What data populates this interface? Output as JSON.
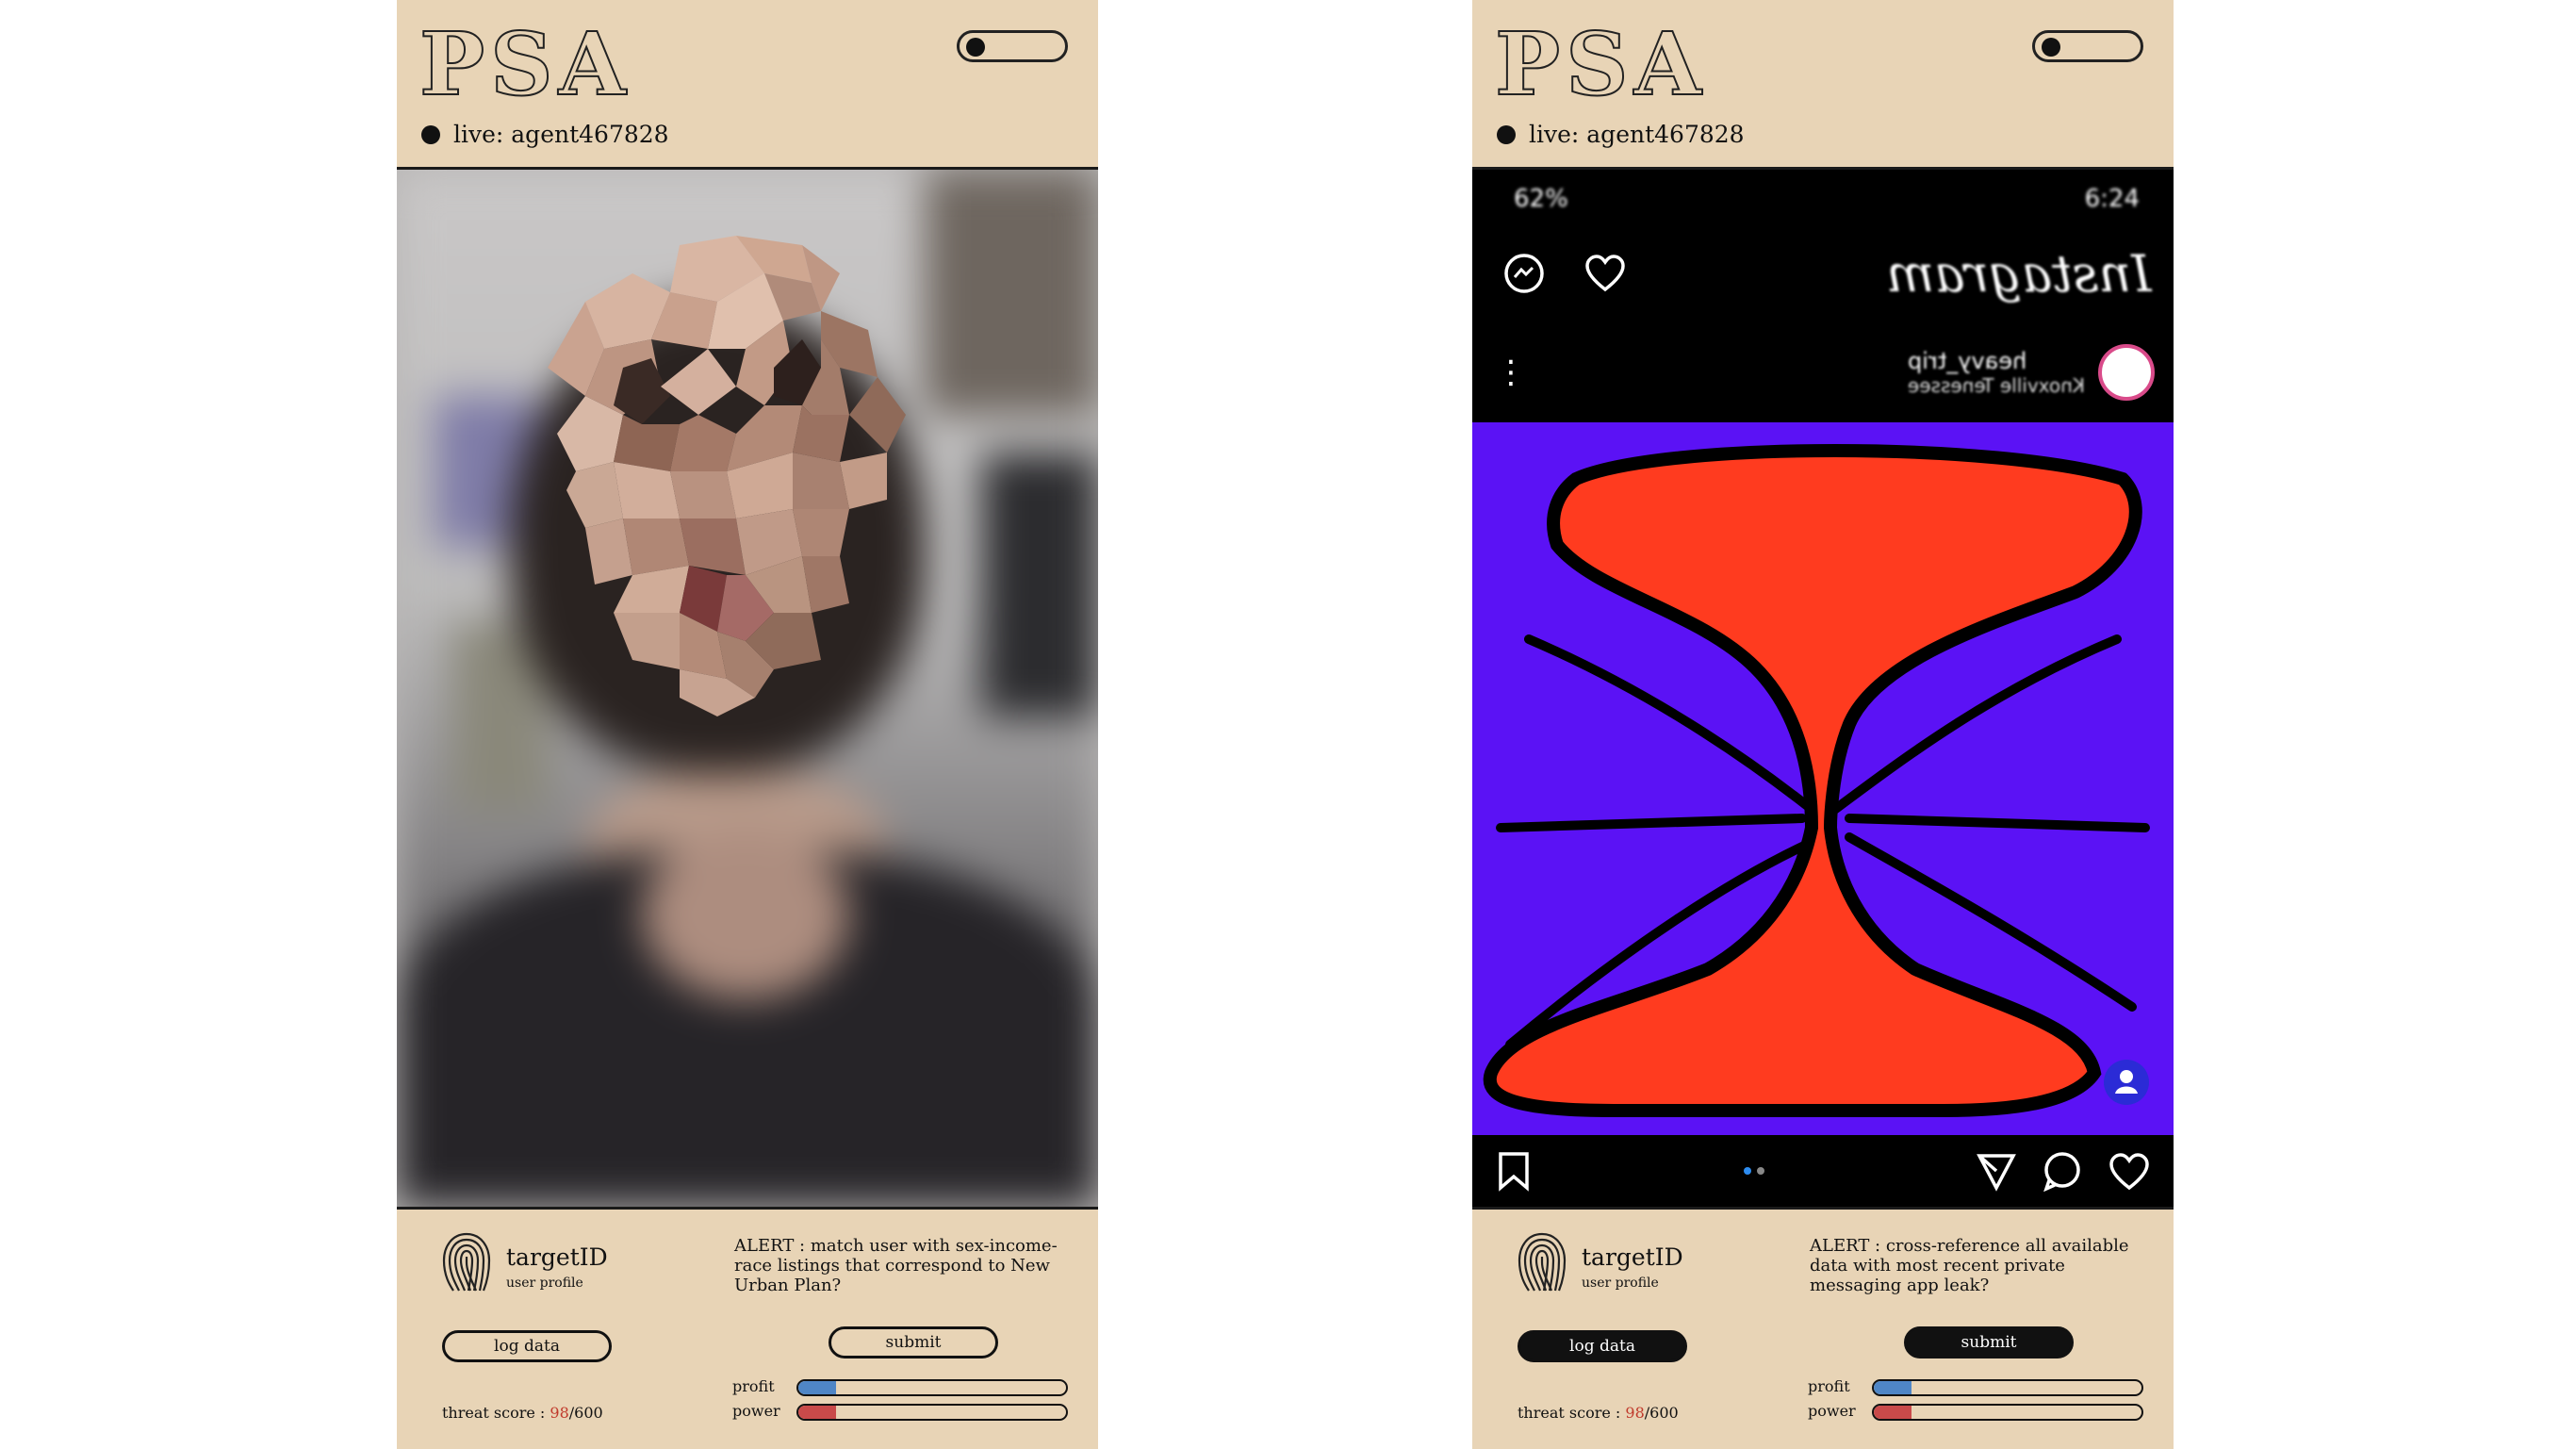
{
  "phones": [
    {
      "logo": "PSA",
      "live_text": "live: agent467828",
      "target_title": "targetID",
      "target_subtitle": "user profile",
      "alert": "ALERT : match user with sex-income-race listings that correspond to New Urban Plan?",
      "log_label": "log data",
      "submit_label": "submit",
      "profit_label": "profit",
      "power_label": "power",
      "profit_level": 0.14,
      "power_level": 0.14,
      "threat_label": "threat score : ",
      "threat_value": "98",
      "threat_max": "/600",
      "button_style": "outline"
    },
    {
      "logo": "PSA",
      "live_text": "live: agent467828",
      "target_title": "targetID",
      "target_subtitle": "user profile",
      "alert": "ALERT : cross-reference all available data with most recent private messaging app leak?",
      "log_label": "log data",
      "submit_label": "submit",
      "profit_label": "profit",
      "power_label": "power",
      "profit_level": 0.14,
      "power_level": 0.14,
      "threat_label": "threat score : ",
      "threat_value": "98",
      "threat_max": "/600",
      "button_style": "filled",
      "feed": {
        "status_left": "62%",
        "status_right": "6:24",
        "app_name": "Instagram",
        "username": "heavy_trip",
        "location": "Knoxville Tenessee"
      }
    }
  ],
  "colors": {
    "panel": "#e8d4b6",
    "profit": "#4f86c6",
    "power": "#c94a4a",
    "threat_number": "#c0392b",
    "art_bg": "#5b12f5",
    "art_fg": "#ff3b1f"
  },
  "icons": [
    "fingerprint-icon",
    "heart-icon",
    "messenger-icon",
    "bookmark-icon",
    "send-icon",
    "comment-icon",
    "user-tag-icon"
  ]
}
